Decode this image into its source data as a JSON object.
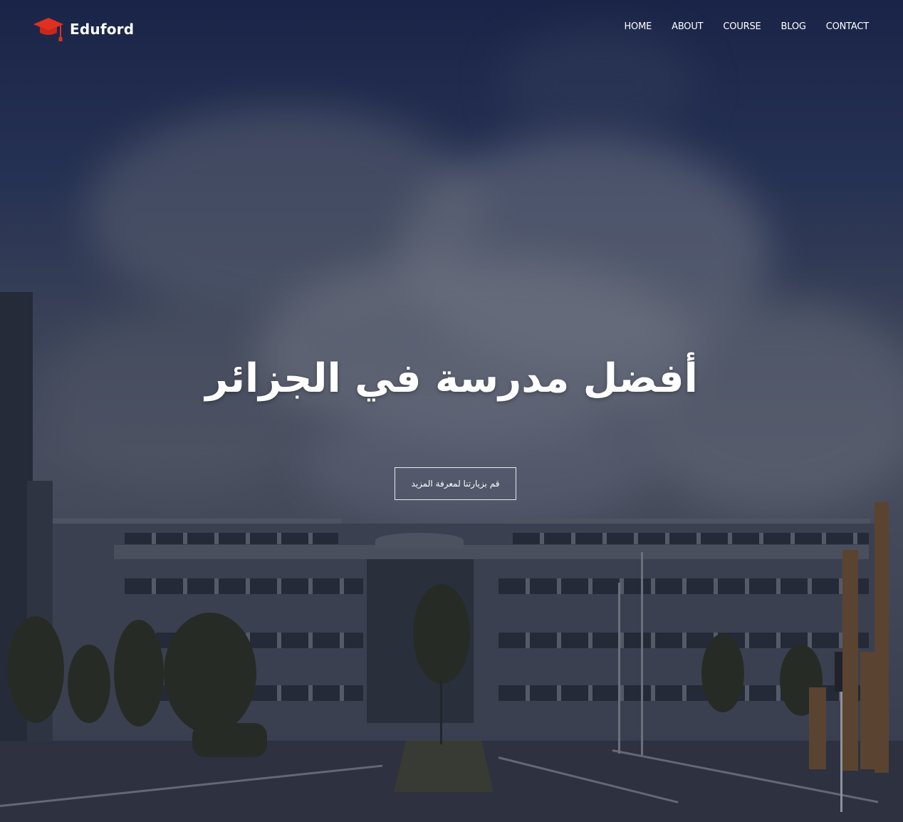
{
  "brand": {
    "name": "Eduford",
    "logo_icon": "graduation-cap-icon",
    "accent_color": "#e0301e"
  },
  "nav": {
    "items": [
      {
        "label": "HOME"
      },
      {
        "label": "ABOUT"
      },
      {
        "label": "COURSE"
      },
      {
        "label": "BLOG"
      },
      {
        "label": "CONTACT"
      }
    ]
  },
  "hero": {
    "title": "أفضل مدرسة في الجزائر",
    "cta_label": "قم بزيارتنا لمعرفة المزيد",
    "background": "school-campus-under-cloudy-sky"
  }
}
